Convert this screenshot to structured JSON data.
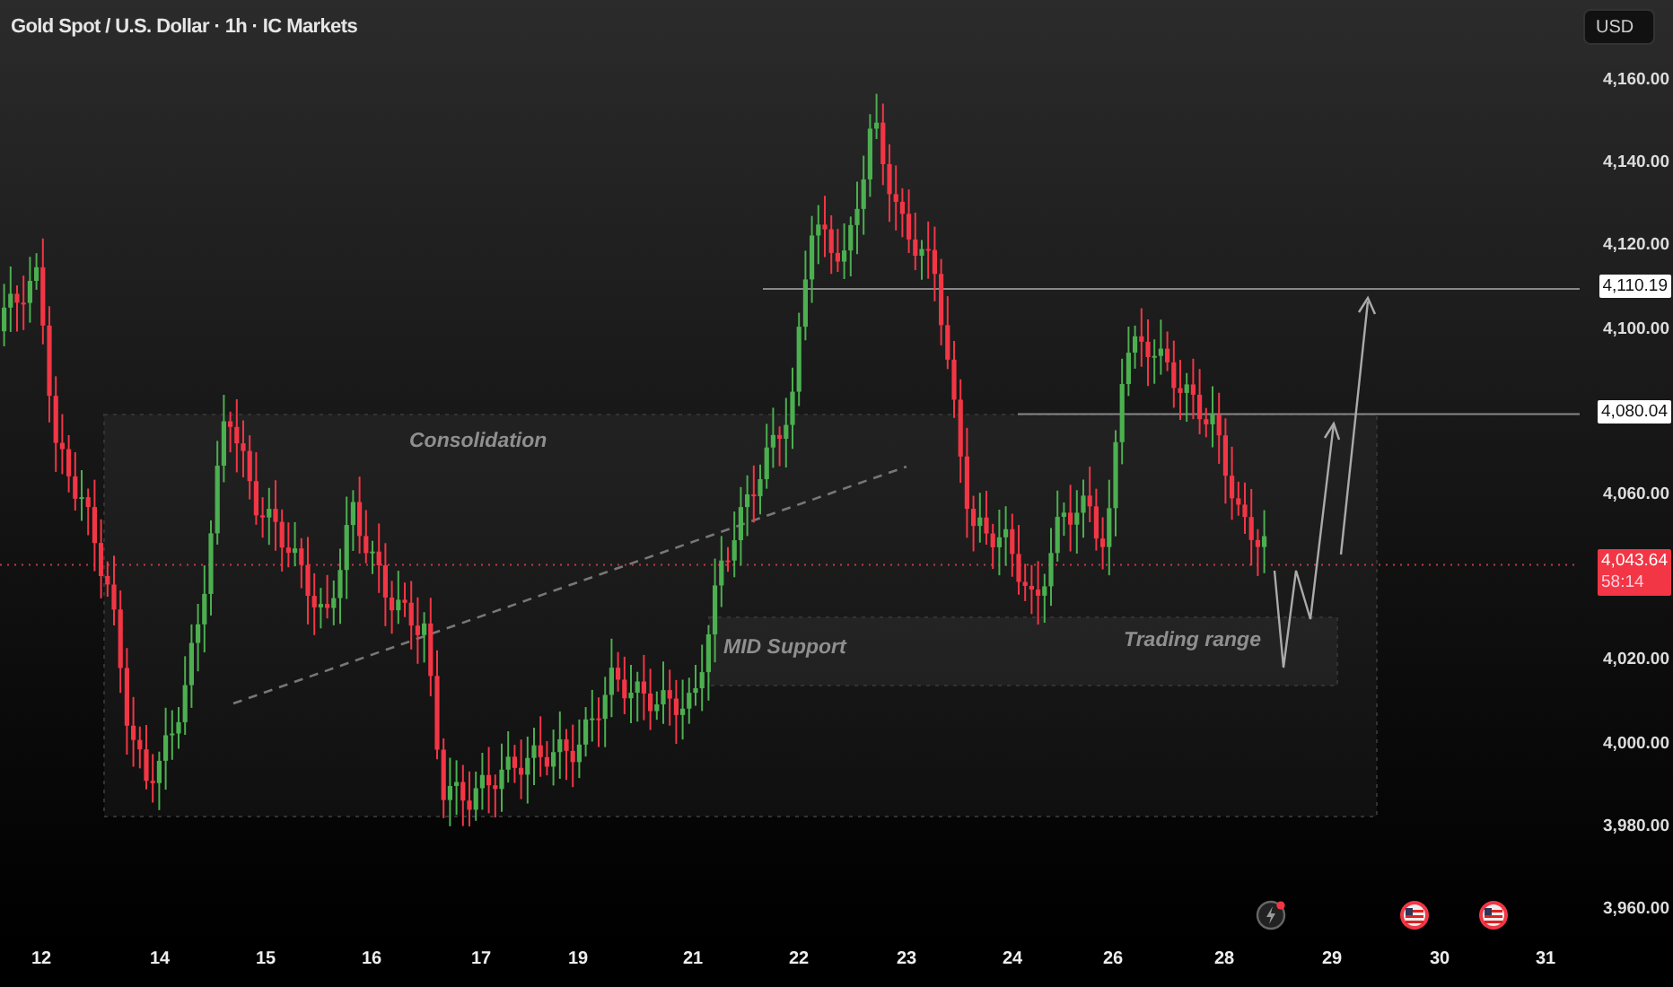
{
  "chart": {
    "title": "Gold Spot / U.S. Dollar · 1h · IC Markets",
    "annotations": [
      "Consolidation",
      "MID Support",
      "Trading range"
    ]
  },
  "price_axis": {
    "currency": "USD",
    "ticks": [
      "4,160.00",
      "4,140.00",
      "4,120.00",
      "4,100.00",
      "4,060.00",
      "4,020.00",
      "4,000.00",
      "3,980.00",
      "3,960.00"
    ],
    "level_labels": [
      "4,110.19",
      "4,080.04"
    ],
    "current_price": {
      "price": "4,043.64",
      "countdown": "58:14"
    }
  },
  "time_axis": {
    "ticks": [
      "12",
      "14",
      "15",
      "16",
      "17",
      "19",
      "21",
      "22",
      "23",
      "24",
      "26",
      "28",
      "29",
      "30",
      "31"
    ]
  }
}
